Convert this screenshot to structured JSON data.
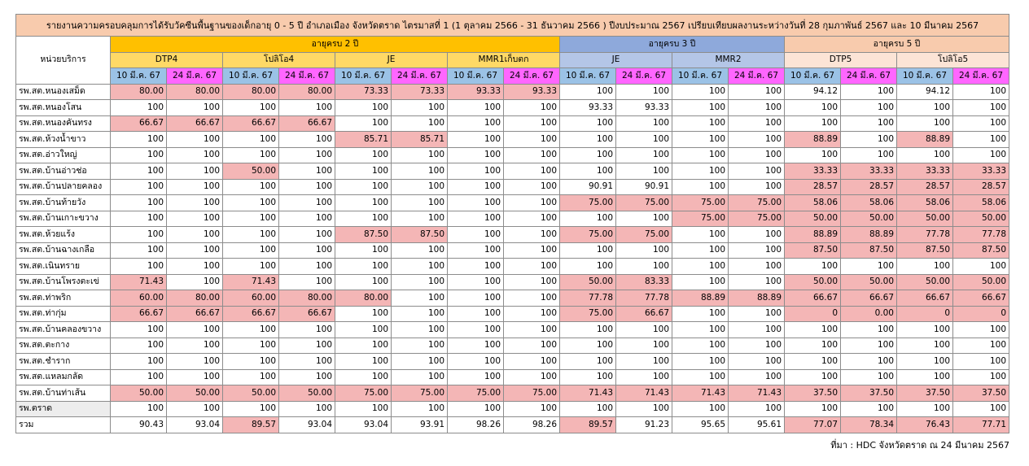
{
  "title": "รายงานความครอบคลุมการได้รับวัคซีนพื้นฐานของเด็กอายุ 0 - 5 ปี อำเภอเมือง จังหวัดตราด ไตรมาสที่ 1 (1 ตุลาคม 2566 - 31 ธันวาคม 2566 ) ปีงบประมาณ 2567 เปรียบเทียบผลงานระหว่างวันที่ 28 กุมภาพันธ์ 2567 และ 10 มีนาคม 2567",
  "unit_header": "หน่วยบริการ",
  "age_groups": [
    "อายุครบ 2 ปี",
    "อายุครบ 3 ปี",
    "อายุครบ 5 ปี"
  ],
  "vaccines": [
    "DTP4",
    "โปลิโอ4",
    "JE",
    "MMR1เก็บตก",
    "JE",
    "MMR2",
    "DTP5",
    "โปลิโอ5"
  ],
  "dates": [
    "10 มี.ค. 67",
    "24 มี.ค. 67"
  ],
  "colors": {
    "title": "#f8cbad",
    "age2": "#ffc000",
    "age3": "#8ea9db",
    "age5": "#f8cbad",
    "low": "#f4b6b6",
    "date1": "#9bc2e6",
    "date2": "#ff66ff"
  },
  "rows": [
    {
      "name": "รพ.สต.หนองเสม็ด",
      "values": [
        "80.00",
        "80.00",
        "80.00",
        "80.00",
        "73.33",
        "73.33",
        "93.33",
        "93.33",
        "100",
        "100",
        "100",
        "100",
        "94.12",
        "100",
        "94.12",
        "100"
      ],
      "low": [
        1,
        1,
        1,
        1,
        1,
        1,
        1,
        1,
        0,
        0,
        0,
        0,
        0,
        0,
        0,
        0
      ]
    },
    {
      "name": "รพ.สต.หนองโสน",
      "values": [
        "100",
        "100",
        "100",
        "100",
        "100",
        "100",
        "100",
        "100",
        "93.33",
        "93.33",
        "100",
        "100",
        "100",
        "100",
        "100",
        "100"
      ],
      "low": [
        0,
        0,
        0,
        0,
        0,
        0,
        0,
        0,
        0,
        0,
        0,
        0,
        0,
        0,
        0,
        0
      ]
    },
    {
      "name": "รพ.สต.หนองคันทรง",
      "values": [
        "66.67",
        "66.67",
        "66.67",
        "66.67",
        "100",
        "100",
        "100",
        "100",
        "100",
        "100",
        "100",
        "100",
        "100",
        "100",
        "100",
        "100"
      ],
      "low": [
        1,
        1,
        1,
        1,
        0,
        0,
        0,
        0,
        0,
        0,
        0,
        0,
        0,
        0,
        0,
        0
      ]
    },
    {
      "name": "รพ.สต.ห้วงน้ำขาว",
      "values": [
        "100",
        "100",
        "100",
        "100",
        "85.71",
        "85.71",
        "100",
        "100",
        "100",
        "100",
        "100",
        "100",
        "88.89",
        "100",
        "88.89",
        "100"
      ],
      "low": [
        0,
        0,
        0,
        0,
        1,
        1,
        0,
        0,
        0,
        0,
        0,
        0,
        1,
        0,
        1,
        0
      ]
    },
    {
      "name": "รพ.สต.อ่าวใหญ่",
      "values": [
        "100",
        "100",
        "100",
        "100",
        "100",
        "100",
        "100",
        "100",
        "100",
        "100",
        "100",
        "100",
        "100",
        "100",
        "100",
        "100"
      ],
      "low": [
        0,
        0,
        0,
        0,
        0,
        0,
        0,
        0,
        0,
        0,
        0,
        0,
        0,
        0,
        0,
        0
      ]
    },
    {
      "name": "รพ.สต.บ้านอ่าวช่อ",
      "values": [
        "100",
        "100",
        "50.00",
        "100",
        "100",
        "100",
        "100",
        "100",
        "100",
        "100",
        "100",
        "100",
        "33.33",
        "33.33",
        "33.33",
        "33.33"
      ],
      "low": [
        0,
        0,
        1,
        0,
        0,
        0,
        0,
        0,
        0,
        0,
        0,
        0,
        1,
        1,
        1,
        1
      ]
    },
    {
      "name": "รพ.สต.บ้านปลายคลอง",
      "values": [
        "100",
        "100",
        "100",
        "100",
        "100",
        "100",
        "100",
        "100",
        "90.91",
        "90.91",
        "100",
        "100",
        "28.57",
        "28.57",
        "28.57",
        "28.57"
      ],
      "low": [
        0,
        0,
        0,
        0,
        0,
        0,
        0,
        0,
        0,
        0,
        0,
        0,
        1,
        1,
        1,
        1
      ]
    },
    {
      "name": "รพ.สต.บ้านท้ายวัง",
      "values": [
        "100",
        "100",
        "100",
        "100",
        "100",
        "100",
        "100",
        "100",
        "75.00",
        "75.00",
        "75.00",
        "75.00",
        "58.06",
        "58.06",
        "58.06",
        "58.06"
      ],
      "low": [
        0,
        0,
        0,
        0,
        0,
        0,
        0,
        0,
        1,
        1,
        1,
        1,
        1,
        1,
        1,
        1
      ]
    },
    {
      "name": "รพ.สต.บ้านเกาะขวาง",
      "values": [
        "100",
        "100",
        "100",
        "100",
        "100",
        "100",
        "100",
        "100",
        "100",
        "100",
        "75.00",
        "75.00",
        "50.00",
        "50.00",
        "50.00",
        "50.00"
      ],
      "low": [
        0,
        0,
        0,
        0,
        0,
        0,
        0,
        0,
        0,
        0,
        1,
        1,
        1,
        1,
        1,
        1
      ]
    },
    {
      "name": "รพ.สต.ห้วยแร้ง",
      "values": [
        "100",
        "100",
        "100",
        "100",
        "87.50",
        "87.50",
        "100",
        "100",
        "75.00",
        "75.00",
        "100",
        "100",
        "88.89",
        "88.89",
        "77.78",
        "77.78"
      ],
      "low": [
        0,
        0,
        0,
        0,
        1,
        1,
        0,
        0,
        1,
        1,
        0,
        0,
        1,
        1,
        1,
        1
      ]
    },
    {
      "name": "รพ.สต.บ้านฉางเกลือ",
      "values": [
        "100",
        "100",
        "100",
        "100",
        "100",
        "100",
        "100",
        "100",
        "100",
        "100",
        "100",
        "100",
        "87.50",
        "87.50",
        "87.50",
        "87.50"
      ],
      "low": [
        0,
        0,
        0,
        0,
        0,
        0,
        0,
        0,
        0,
        0,
        0,
        0,
        1,
        1,
        1,
        1
      ]
    },
    {
      "name": "รพ.สต.เนินทราย",
      "values": [
        "100",
        "100",
        "100",
        "100",
        "100",
        "100",
        "100",
        "100",
        "100",
        "100",
        "100",
        "100",
        "100",
        "100",
        "100",
        "100"
      ],
      "low": [
        0,
        0,
        0,
        0,
        0,
        0,
        0,
        0,
        0,
        0,
        0,
        0,
        0,
        0,
        0,
        0
      ]
    },
    {
      "name": "รพ.สต.บ้านโพรงตะเข่",
      "values": [
        "71.43",
        "100",
        "71.43",
        "100",
        "100",
        "100",
        "100",
        "100",
        "50.00",
        "83.33",
        "100",
        "100",
        "50.00",
        "50.00",
        "50.00",
        "50.00"
      ],
      "low": [
        1,
        0,
        1,
        0,
        0,
        0,
        0,
        0,
        1,
        1,
        0,
        0,
        1,
        1,
        1,
        1
      ]
    },
    {
      "name": "รพ.สต.ท่าพริก",
      "values": [
        "60.00",
        "80.00",
        "60.00",
        "80.00",
        "80.00",
        "100",
        "100",
        "100",
        "77.78",
        "77.78",
        "88.89",
        "88.89",
        "66.67",
        "66.67",
        "66.67",
        "66.67"
      ],
      "low": [
        1,
        1,
        1,
        1,
        1,
        0,
        0,
        0,
        1,
        1,
        1,
        1,
        1,
        1,
        1,
        1
      ]
    },
    {
      "name": "รพ.สต.ท่ากุ่ม",
      "values": [
        "66.67",
        "66.67",
        "66.67",
        "66.67",
        "100",
        "100",
        "100",
        "100",
        "75.00",
        "66.67",
        "100",
        "100",
        "0",
        "0.00",
        "0",
        "0"
      ],
      "low": [
        1,
        1,
        1,
        1,
        0,
        0,
        0,
        0,
        1,
        1,
        0,
        0,
        1,
        1,
        1,
        1
      ]
    },
    {
      "name": "รพ.สต.บ้านคลองขวาง",
      "values": [
        "100",
        "100",
        "100",
        "100",
        "100",
        "100",
        "100",
        "100",
        "100",
        "100",
        "100",
        "100",
        "100",
        "100",
        "100",
        "100"
      ],
      "low": [
        0,
        0,
        0,
        0,
        0,
        0,
        0,
        0,
        0,
        0,
        0,
        0,
        0,
        0,
        0,
        0
      ]
    },
    {
      "name": "รพ.สต.ตะกาง",
      "values": [
        "100",
        "100",
        "100",
        "100",
        "100",
        "100",
        "100",
        "100",
        "100",
        "100",
        "100",
        "100",
        "100",
        "100",
        "100",
        "100"
      ],
      "low": [
        0,
        0,
        0,
        0,
        0,
        0,
        0,
        0,
        0,
        0,
        0,
        0,
        0,
        0,
        0,
        0
      ]
    },
    {
      "name": "รพ.สต.ชำราก",
      "values": [
        "100",
        "100",
        "100",
        "100",
        "100",
        "100",
        "100",
        "100",
        "100",
        "100",
        "100",
        "100",
        "100",
        "100",
        "100",
        "100"
      ],
      "low": [
        0,
        0,
        0,
        0,
        0,
        0,
        0,
        0,
        0,
        0,
        0,
        0,
        0,
        0,
        0,
        0
      ]
    },
    {
      "name": "รพ.สต.แหลมกลัด",
      "values": [
        "100",
        "100",
        "100",
        "100",
        "100",
        "100",
        "100",
        "100",
        "100",
        "100",
        "100",
        "100",
        "100",
        "100",
        "100",
        "100"
      ],
      "low": [
        0,
        0,
        0,
        0,
        0,
        0,
        0,
        0,
        0,
        0,
        0,
        0,
        0,
        0,
        0,
        0
      ]
    },
    {
      "name": "รพ.สต.บ้านท่าเส้น",
      "values": [
        "50.00",
        "50.00",
        "50.00",
        "50.00",
        "75.00",
        "75.00",
        "75.00",
        "75.00",
        "71.43",
        "71.43",
        "71.43",
        "71.43",
        "37.50",
        "37.50",
        "37.50",
        "37.50"
      ],
      "low": [
        1,
        1,
        1,
        1,
        1,
        1,
        1,
        1,
        1,
        1,
        1,
        1,
        1,
        1,
        1,
        1
      ]
    },
    {
      "name": "รพ.ตราด",
      "values": [
        "100",
        "100",
        "100",
        "100",
        "100",
        "100",
        "100",
        "100",
        "100",
        "100",
        "100",
        "100",
        "100",
        "100",
        "100",
        "100"
      ],
      "low": [
        0,
        0,
        0,
        0,
        0,
        0,
        0,
        0,
        0,
        0,
        0,
        0,
        0,
        0,
        0,
        0
      ],
      "gray": true
    },
    {
      "name": "รวม",
      "values": [
        "90.43",
        "93.04",
        "89.57",
        "93.04",
        "93.04",
        "93.91",
        "98.26",
        "98.26",
        "89.57",
        "91.23",
        "95.65",
        "95.61",
        "77.07",
        "78.34",
        "76.43",
        "77.71"
      ],
      "low": [
        0,
        0,
        1,
        0,
        0,
        0,
        0,
        0,
        1,
        0,
        0,
        0,
        1,
        1,
        1,
        1
      ]
    }
  ],
  "source": "ที่มา : HDC จังหวัดตราด ณ 24 มีนาคม 2567"
}
